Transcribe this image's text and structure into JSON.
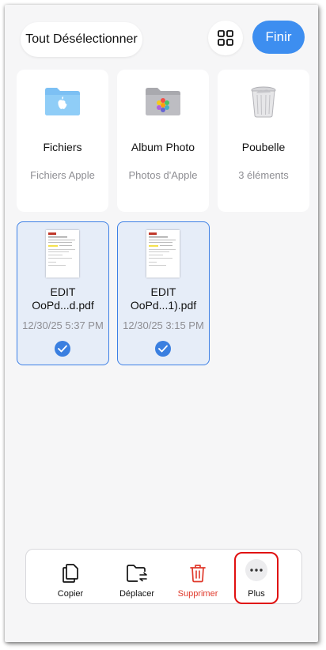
{
  "header": {
    "deselect_label": "Tout Désélectionner",
    "done_label": "Finir",
    "accent": "#3d8ef0"
  },
  "locations": [
    {
      "title": "Fichiers",
      "subtitle": "Fichiers Apple",
      "icon": "apple-folder-icon"
    },
    {
      "title": "Album Photo",
      "subtitle": "Photos d'Apple",
      "icon": "photos-folder-icon"
    },
    {
      "title": "Poubelle",
      "subtitle": "3 éléments",
      "icon": "trash-bin-icon"
    }
  ],
  "documents": [
    {
      "name_line1": "EDIT",
      "name_line2": "OoPd...d.pdf",
      "date": "12/30/25 5:37 PM",
      "selected": true
    },
    {
      "name_line1": "EDIT",
      "name_line2": "OoPd...1).pdf",
      "date": "12/30/25 3:15 PM",
      "selected": true
    }
  ],
  "toolbar": {
    "copy_label": "Copier",
    "move_label": "Déplacer",
    "delete_label": "Supprimer",
    "more_label": "Plus",
    "delete_color": "#e0392b"
  }
}
